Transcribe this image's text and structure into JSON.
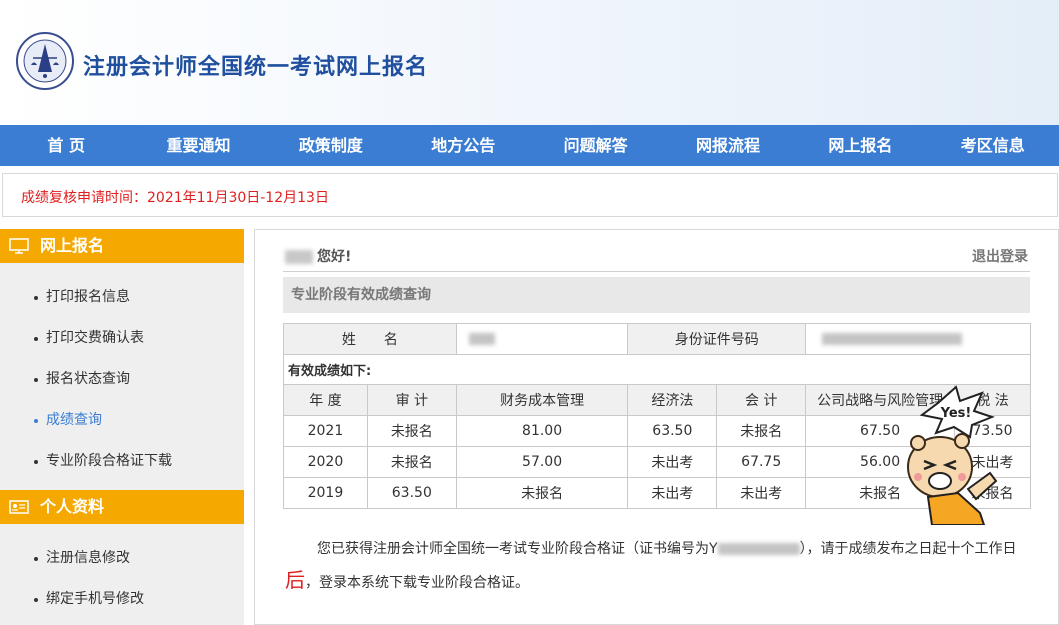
{
  "header": {
    "title": "注册会计师全国统一考试网上报名",
    "logo_icon": "cicpa-emblem-icon"
  },
  "nav": [
    "首 页",
    "重要通知",
    "政策制度",
    "地方公告",
    "问题解答",
    "网报流程",
    "网上报名",
    "考区信息"
  ],
  "notice": "成绩复核申请时间：2021年11月30日-12月13日",
  "sidebar": {
    "section1": {
      "title": "网上报名",
      "icon": "monitor-icon",
      "items": [
        "打印报名信息",
        "打印交费确认表",
        "报名状态查询",
        "成绩查询",
        "专业阶段合格证下载"
      ]
    },
    "section2": {
      "title": "个人资料",
      "icon": "id-card-icon",
      "items": [
        "注册信息修改",
        "绑定手机号修改"
      ]
    },
    "active_item": "成绩查询"
  },
  "main": {
    "greeting": "您好!",
    "logout": "退出登录",
    "section_title": "专业阶段有效成绩查询",
    "info": {
      "name_label": "姓　　名",
      "id_label": "身份证件号码"
    },
    "caption": "有效成绩如下:",
    "columns": [
      "年 度",
      "审 计",
      "财务成本管理",
      "经济法",
      "会 计",
      "公司战略与风险管理",
      "税 法"
    ],
    "rows": [
      [
        "2021",
        "未报名",
        "81.00",
        "63.50",
        "未报名",
        "67.50",
        "73.50"
      ],
      [
        "2020",
        "未报名",
        "57.00",
        "未出考",
        "67.75",
        "56.00",
        "未出考"
      ],
      [
        "2019",
        "63.50",
        "未报名",
        "未出考",
        "未出考",
        "未报名",
        "未报名"
      ]
    ],
    "message_part1": "您已获得注册会计师全国统一考试专业阶段合格证（证书编号为Y",
    "message_part2": "），请于成绩发布之日起十个工作日",
    "message_emph": "后",
    "message_part3": "，登录本系统下载专业阶段合格证。"
  },
  "mascot": {
    "text": "Yes!",
    "icon": "cartoon-mascot-icon"
  },
  "colors": {
    "nav": "#3b7dd2",
    "sidebar_head": "#f5a800",
    "notice": "#e02020",
    "title": "#1f4f9e"
  }
}
